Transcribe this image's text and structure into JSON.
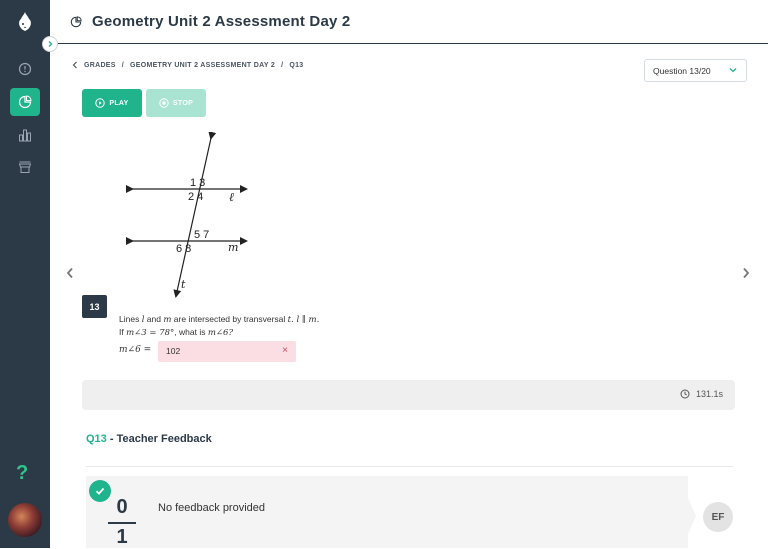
{
  "header": {
    "title": "Geometry Unit 2 Assessment Day 2"
  },
  "breadcrumb": {
    "items": [
      "GRADES",
      "GEOMETRY UNIT 2 ASSESSMENT DAY 2",
      "Q13"
    ],
    "separator": "/"
  },
  "question_select": {
    "value": "Question 13/20"
  },
  "controls": {
    "play_label": "PLAY",
    "stop_label": "STOP"
  },
  "question": {
    "number": "13",
    "text_parts": [
      "Lines",
      "l",
      "and",
      "m",
      "are intersected by transversal",
      "t. l ∥ m."
    ],
    "line2_parts": [
      "If",
      "m∠3 = 78°",
      ", what is",
      "m∠6?"
    ],
    "answer_label": "m∠6 =",
    "answer_value": "102",
    "answer_status": "incorrect"
  },
  "diagram": {
    "labels_top": "1 3",
    "labels_top2": "2 4",
    "labels_bottom": "5 7",
    "labels_bottom2": "6 8",
    "line_l": "ℓ",
    "line_m": "m",
    "line_t": "t"
  },
  "timer": {
    "value": "131.1s"
  },
  "feedback": {
    "title_q": "Q13",
    "title_rest": " - Teacher Feedback",
    "score_num": "0",
    "score_den": "1",
    "text": "No feedback provided",
    "teacher_initials": "EF"
  },
  "colors": {
    "accent": "#1fb48c",
    "sidebar": "#2c3a47",
    "error_bg": "#fbdde4"
  },
  "icons": [
    "logo-icon",
    "collapse-icon",
    "info-icon",
    "pie-chart-icon",
    "bar-chart-icon",
    "store-icon",
    "help-icon",
    "play-icon",
    "stop-icon",
    "clock-icon",
    "check-icon",
    "chevron-left-icon",
    "chevron-right-icon",
    "chevron-down-icon",
    "close-icon"
  ]
}
